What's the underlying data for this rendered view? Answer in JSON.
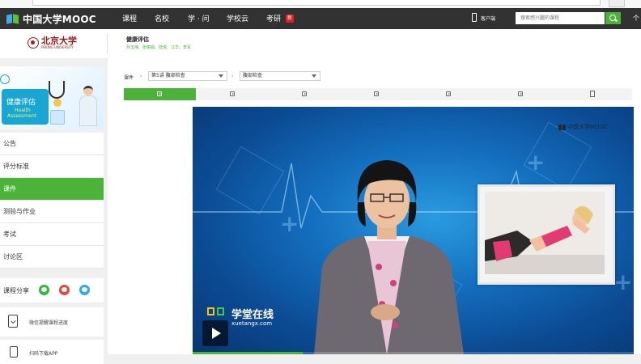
{
  "navbar": {
    "logo": "中国大学MOOC",
    "items": [
      "课程",
      "名校",
      "学 · 问",
      "学校云",
      "考研"
    ],
    "new_badge": "新",
    "client": "客户端",
    "search_placeholder": "搜索感兴趣的课程",
    "user": "个"
  },
  "course": {
    "university": "北京大学",
    "university_en": "PEKING UNIVERSITY",
    "title": "健康评估",
    "teachers": "孙玉梅、张丽娟、陆悦、江华、李军"
  },
  "sidebar": {
    "banner": {
      "title_cn": "健康评估",
      "title_en_1": "Health",
      "title_en_2": "Assessment"
    },
    "menu": [
      {
        "label": "公告",
        "active": false
      },
      {
        "label": "评分标准",
        "active": false
      },
      {
        "label": "课件",
        "active": true
      },
      {
        "label": "测验与作业",
        "active": false
      },
      {
        "label": "考试",
        "active": false
      },
      {
        "label": "讨论区",
        "active": false
      }
    ],
    "share_label": "课程分享",
    "wechat_reminder": "微信提醒课程进度",
    "app_download": "扫码下载APP"
  },
  "breadcrumb": {
    "root": "课件",
    "chapter": "第5讲 腹部检查",
    "lesson": "腹部检查"
  },
  "tabs": [
    "video",
    "video",
    "video",
    "video",
    "video",
    "video",
    "doc"
  ],
  "active_tab": 0,
  "video": {
    "watermark": "中国大学MOOC",
    "brand_cn": "学堂在线",
    "brand_en": "xuetangx.com",
    "progress": 0.25
  },
  "colors": {
    "accent": "#4cb33a",
    "navbar": "#323232",
    "video_blue": "#1470c0"
  }
}
